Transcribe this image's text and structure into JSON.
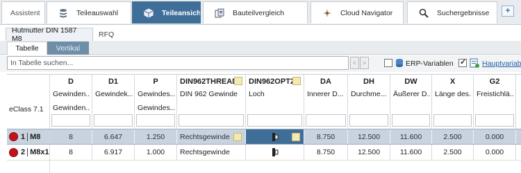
{
  "main_tabs": [
    {
      "label": "Assistent",
      "icon": "assistant-icon"
    },
    {
      "label": "Teileauswahl",
      "icon": "stack-icon"
    },
    {
      "label": "Teileansicht",
      "icon": "cube-icon",
      "active": true
    },
    {
      "label": "Bauteilvergleich",
      "icon": "compare-icon"
    },
    {
      "label": "Cloud Navigator",
      "icon": "cloud-navigator-icon"
    },
    {
      "label": "Suchergebnisse",
      "icon": "search-icon"
    }
  ],
  "add_tab_label": "+",
  "sub_tabs": {
    "part": "Hutmutter DIN 1587 M8",
    "rfq": "RFQ"
  },
  "view_tabs": {
    "tabelle": "Tabelle",
    "vertikal": "Vertikal"
  },
  "toolbar": {
    "search_placeholder": "In Tabelle suchen...",
    "prev": "<",
    "next": ">",
    "erp_label": "ERP-Variablen",
    "erp_checked": false,
    "haupt_label": "Hauptvariablen",
    "haupt_checked": true
  },
  "grid": {
    "eclass_label": "eClass 7.1",
    "columns": [
      {
        "code": "D",
        "name": "Gewinden...",
        "name2": "Gewinden..."
      },
      {
        "code": "D1",
        "name": "Gewindek...",
        "name2": ""
      },
      {
        "code": "P",
        "name": "Gewindes...",
        "name2": "Gewindes..."
      },
      {
        "code": "DIN962THREAD",
        "name": "DIN 962 Gewinde",
        "name2": "",
        "editable": true
      },
      {
        "code": "DIN962OPT2",
        "name": "Loch",
        "name2": "",
        "editable": true
      },
      {
        "code": "DA",
        "name": "Innerer D...",
        "name2": ""
      },
      {
        "code": "DH",
        "name": "Durchme...",
        "name2": ""
      },
      {
        "code": "DW",
        "name": "Äußerer D...",
        "name2": ""
      },
      {
        "code": "X",
        "name": "Länge des...",
        "name2": ""
      },
      {
        "code": "G2",
        "name": "Freistichlä...",
        "name2": ""
      }
    ],
    "rows": [
      {
        "num": "1",
        "key": "M8",
        "selected": true,
        "D": "8",
        "D1": "6.647",
        "P": "1.250",
        "THREAD": "Rechtsgewinde",
        "DA": "8.750",
        "DH": "12.500",
        "DW": "11.600",
        "X": "2.500",
        "G2": "0.000"
      },
      {
        "num": "2",
        "key": "M8x1",
        "selected": false,
        "D": "8",
        "D1": "6.917",
        "P": "1.000",
        "THREAD": "Rechtsgewinde",
        "DA": "8.750",
        "DH": "12.500",
        "DW": "11.600",
        "X": "2.500",
        "G2": "0.000"
      }
    ]
  },
  "colors": {
    "accent": "#3f6f99",
    "selected_row": "#c8d3df",
    "status_dot": "#c4121a",
    "link": "#1d5fa8"
  }
}
